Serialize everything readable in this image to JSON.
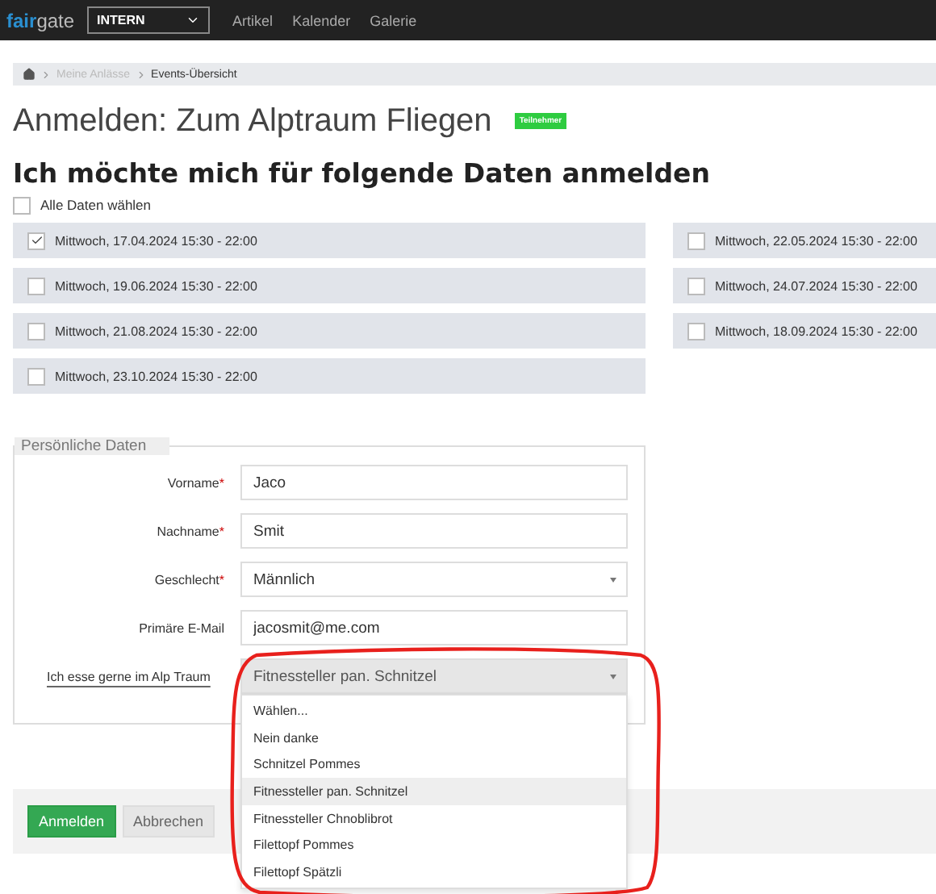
{
  "nav": {
    "logo": {
      "accent": "fair",
      "rest": "gate"
    },
    "context_select": "INTERN",
    "links": [
      "Artikel",
      "Kalender",
      "Galerie"
    ]
  },
  "breadcrumb": [
    {
      "label": "Meine Anlässe",
      "current": false
    },
    {
      "label": "Events-Übersicht",
      "current": true
    }
  ],
  "page": {
    "title": "Anmelden: Zum Alptraum Fliegen",
    "badge": "Teilnehmer"
  },
  "dates": {
    "heading": "Ich möchte mich für folgende Daten anmelden",
    "select_all": {
      "label": "Alle Daten wählen",
      "checked": false
    },
    "columns": [
      [
        {
          "label": "Mittwoch, 17.04.2024 15:30 - 22:00",
          "checked": true
        },
        {
          "label": "Mittwoch, 19.06.2024 15:30 - 22:00",
          "checked": false
        },
        {
          "label": "Mittwoch, 21.08.2024 15:30 - 22:00",
          "checked": false
        },
        {
          "label": "Mittwoch, 23.10.2024 15:30 - 22:00",
          "checked": false
        }
      ],
      [
        {
          "label": "Mittwoch, 22.05.2024 15:30 - 22:00",
          "checked": false
        },
        {
          "label": "Mittwoch, 24.07.2024 15:30 - 22:00",
          "checked": false
        },
        {
          "label": "Mittwoch, 18.09.2024 15:30 - 22:00",
          "checked": false
        }
      ]
    ]
  },
  "personal": {
    "legend": "Persönliche Daten",
    "fields": [
      {
        "label": "Vorname",
        "required_mark": "*",
        "has_help": false,
        "kind": "text",
        "value": "Jaco"
      },
      {
        "label": "Nachname",
        "required_mark": "*",
        "has_help": false,
        "kind": "text",
        "value": "Smit"
      },
      {
        "label": "Geschlecht",
        "required_mark": "*",
        "has_help": false,
        "kind": "select",
        "value": "Männlich",
        "open": false
      },
      {
        "label": "Primäre E-Mail",
        "has_help": false,
        "kind": "text",
        "value": "jacosmit@me.com"
      },
      {
        "label": "Ich esse gerne im Alp Traum",
        "has_help": true,
        "kind": "select",
        "value": "Fitnessteller pan. Schnitzel",
        "open": true,
        "options": [
          {
            "label": "Wählen...",
            "selected": false
          },
          {
            "label": "Nein danke",
            "selected": false
          },
          {
            "label": "Schnitzel Pommes",
            "selected": false
          },
          {
            "label": "Fitnessteller pan. Schnitzel",
            "selected": true
          },
          {
            "label": "Fitnessteller Chnoblibrot",
            "selected": false
          },
          {
            "label": "Filettopf Pommes",
            "selected": false
          },
          {
            "label": "Filettopf Spätzli",
            "selected": false
          }
        ]
      }
    ]
  },
  "buttons": [
    {
      "label": "Anmelden",
      "kind": "primary"
    },
    {
      "label": "Abbrechen",
      "kind": "secondary"
    }
  ],
  "markup": {
    "kind": "freehand_ring"
  }
}
